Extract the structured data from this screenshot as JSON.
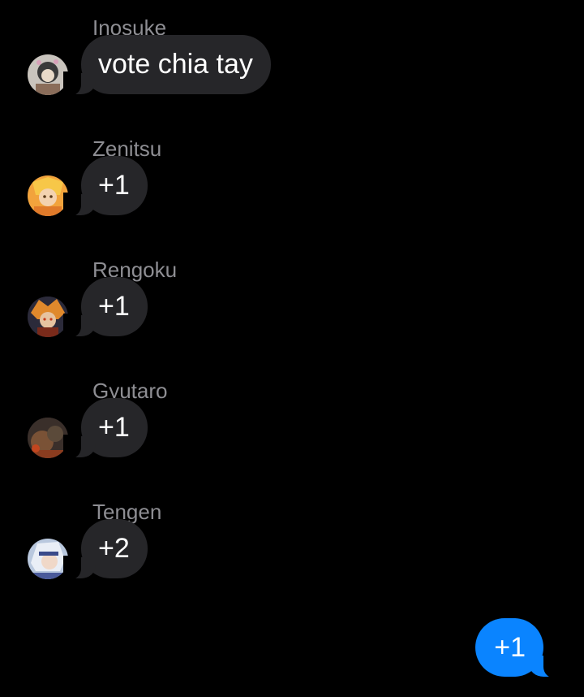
{
  "conversation": {
    "messages": [
      {
        "sender": "Inosuke",
        "text": "vote chia tay",
        "avatar_icon": "inosuke-avatar-icon"
      },
      {
        "sender": "Zenitsu",
        "text": "+1",
        "avatar_icon": "zenitsu-avatar-icon"
      },
      {
        "sender": "Rengoku",
        "text": "+1",
        "avatar_icon": "rengoku-avatar-icon"
      },
      {
        "sender": "Gyutaro",
        "text": "+1",
        "avatar_icon": "gyutaro-avatar-icon"
      },
      {
        "sender": "Tengen",
        "text": "+2",
        "avatar_icon": "tengen-avatar-icon"
      }
    ],
    "outgoing": {
      "text": "+1"
    }
  },
  "colors": {
    "background": "#000000",
    "incoming_bubble": "#262629",
    "outgoing_bubble": "#0a84ff",
    "sender_name": "#8e8e93"
  }
}
